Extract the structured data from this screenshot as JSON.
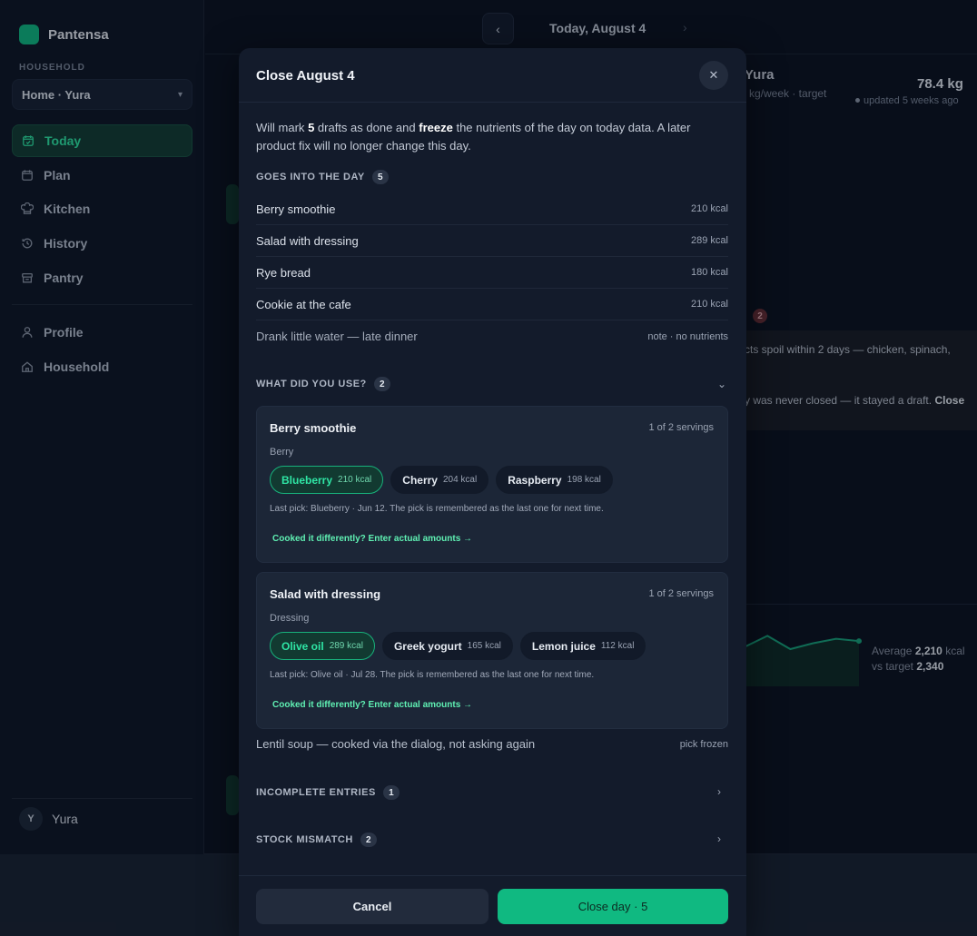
{
  "app": {
    "brand": "Pantensa",
    "household_label": "HOUSEHOLD",
    "household_value": "Home · Yura",
    "nav": [
      {
        "label": "Today"
      },
      {
        "label": "Plan"
      },
      {
        "label": "Kitchen"
      },
      {
        "label": "History"
      },
      {
        "label": "Pantry"
      }
    ],
    "nav2": [
      {
        "label": "Profile"
      },
      {
        "label": "Household"
      }
    ],
    "user_initial": "Y",
    "user_name": "Yura"
  },
  "topbar": {
    "date": "Today, August 4",
    "prev": "‹",
    "next": "›"
  },
  "background": {
    "name": "Yura",
    "sub": "kg/week · target",
    "weight": "78.4 kg",
    "updated": "updated 5 weeks ago",
    "badge": "2",
    "alert1": "cts spoil within 2 days — chicken, spinach,",
    "alert2_text": "y was never closed — it stayed a draft.",
    "alert2_bold": "Close",
    "avg_label": "Average",
    "avg_value": "2,210",
    "avg_unit": "kcal",
    "target_label": "vs target",
    "target_value": "2,340"
  },
  "modal": {
    "title": "Close August 4",
    "close_glyph": "✕",
    "intro_1": "Will mark",
    "intro_count": "5",
    "intro_2": "drafts as done and",
    "intro_bold": "freeze",
    "intro_3": "the nutrients of the day on today data. A later product fix will no longer change this day.",
    "goes_label": "GOES INTO THE DAY",
    "goes_count": "5",
    "day_items": [
      {
        "name": "Berry smoothie",
        "value": "210 kcal"
      },
      {
        "name": "Salad with dressing",
        "value": "289 kcal"
      },
      {
        "name": "Rye bread",
        "value": "180 kcal"
      },
      {
        "name": "Cookie at the cafe",
        "value": "210 kcal"
      },
      {
        "name": "Drank little water — late dinner",
        "value": "note · no nutrients"
      }
    ],
    "used_label": "WHAT DID YOU USE?",
    "used_count": "2",
    "cards": [
      {
        "name": "Berry smoothie",
        "servings": "1 of 2 servings",
        "group": "Berry",
        "options": [
          {
            "label": "Blueberry",
            "kcal": "210 kcal"
          },
          {
            "label": "Cherry",
            "kcal": "204 kcal"
          },
          {
            "label": "Raspberry",
            "kcal": "198 kcal"
          }
        ],
        "last_pick": "Last pick: Blueberry · Jun 12. The pick is remembered as the last one for next time.",
        "link": "Cooked it differently? Enter actual amounts →"
      },
      {
        "name": "Salad with dressing",
        "servings": "1 of 2 servings",
        "group": "Dressing",
        "options": [
          {
            "label": "Olive oil",
            "kcal": "289 kcal"
          },
          {
            "label": "Greek yogurt",
            "kcal": "165 kcal"
          },
          {
            "label": "Lemon juice",
            "kcal": "112 kcal"
          }
        ],
        "last_pick": "Last pick: Olive oil · Jul 28. The pick is remembered as the last one for next time.",
        "link": "Cooked it differently? Enter actual amounts →"
      }
    ],
    "frozen_row": {
      "name": "Lentil soup — cooked via the dialog, not asking again",
      "value": "pick frozen"
    },
    "incomplete_label": "INCOMPLETE ENTRIES",
    "incomplete_count": "1",
    "mismatch_label": "STOCK MISMATCH",
    "mismatch_count": "2",
    "cancel": "Cancel",
    "confirm": "Close day · 5"
  },
  "colors": {
    "accent": "#10b981",
    "selected_chip_border": "#18b27c",
    "link": "#5ff0b3",
    "danger_badge": "#6a2f36"
  },
  "chart_data": {
    "type": "line",
    "series": [
      {
        "values": [
          2150,
          2300,
          2120,
          2200,
          2260,
          2230
        ]
      }
    ],
    "ylim": [
      1800,
      2600
    ]
  }
}
